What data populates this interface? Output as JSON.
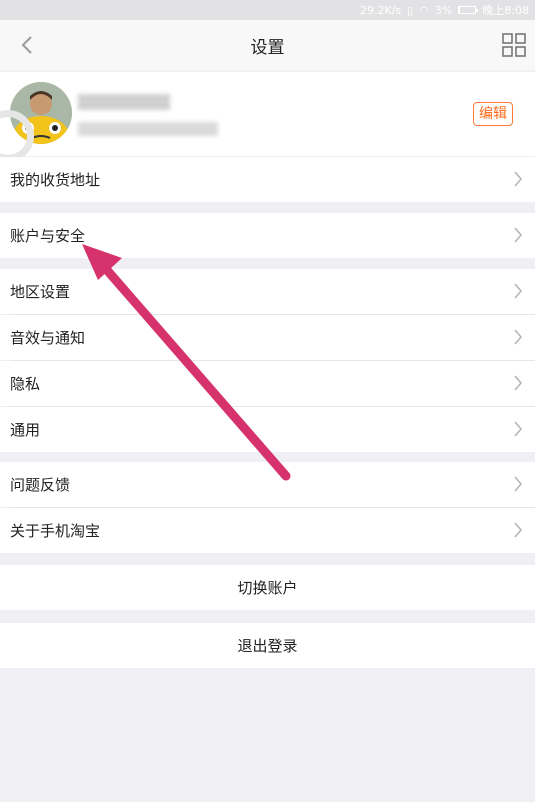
{
  "status_bar": {
    "speed": "29.2K/s",
    "battery": "3%",
    "time": "晚上8:08"
  },
  "nav": {
    "title": "设置"
  },
  "profile": {
    "edit_label": "编辑"
  },
  "menu": {
    "address": "我的收货地址",
    "account_security": "账户与安全",
    "region": "地区设置",
    "sound_notify": "音效与通知",
    "privacy": "隐私",
    "general": "通用",
    "feedback": "问题反馈",
    "about": "关于手机淘宝"
  },
  "actions": {
    "switch_account": "切换账户",
    "logout": "退出登录"
  },
  "colors": {
    "accent": "#ff6a1a",
    "annotation_arrow": "#d6336c"
  }
}
